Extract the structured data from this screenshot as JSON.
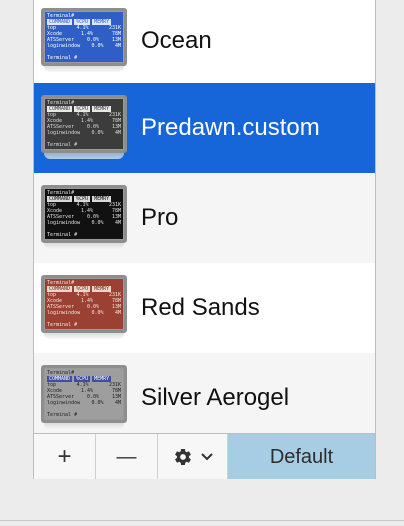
{
  "themes": [
    {
      "name": "Ocean",
      "bg": "#2f5fc6",
      "fg": "#ffffff",
      "hdr_bg": "#dfe7ff",
      "hdr_fg": "#2f5fc6",
      "hdr_label": "Terminal#",
      "footer": "Terminal #",
      "selected": false,
      "alt": false
    },
    {
      "name": "Predawn.custom",
      "bg": "#3c3c3c",
      "fg": "#dcdcdc",
      "hdr_bg": "#e8e8e8",
      "hdr_fg": "#3c3c3c",
      "hdr_label": "Terminal#",
      "footer": "Terminal #",
      "selected": true,
      "alt": false
    },
    {
      "name": "Pro",
      "bg": "#111111",
      "fg": "#e0e0e0",
      "hdr_bg": "#d8d8d8",
      "hdr_fg": "#111111",
      "hdr_label": "Terminal#",
      "footer": "Terminal #",
      "selected": false,
      "alt": true
    },
    {
      "name": "Red Sands",
      "bg": "#9b4033",
      "fg": "#f1e6dc",
      "hdr_bg": "#e8d8cc",
      "hdr_fg": "#7a2c23",
      "hdr_label": "Terminal#",
      "footer": "Terminal #",
      "selected": false,
      "alt": false
    },
    {
      "name": "Silver Aerogel",
      "bg": "#9e9e9e",
      "fg": "#222222",
      "hdr_bg": "#3f4f9e",
      "hdr_fg": "#ffffff",
      "hdr_label": "Terminal#",
      "footer": "Terminal #",
      "selected": false,
      "alt": true
    }
  ],
  "thumb_table": {
    "header": [
      "COMMAND",
      "%CPU",
      "MEMRY"
    ],
    "rows": [
      [
        "top",
        "4.1%",
        "231K"
      ],
      [
        "Xcode",
        "1.4%",
        "78M"
      ],
      [
        "ATSServer",
        "0.0%",
        "13M"
      ],
      [
        "loginwindow",
        "0.0%",
        "4M"
      ]
    ]
  },
  "toolbar": {
    "add_label": "+",
    "remove_label": "—",
    "gear_icon": "gear-icon",
    "default_label": "Default"
  }
}
